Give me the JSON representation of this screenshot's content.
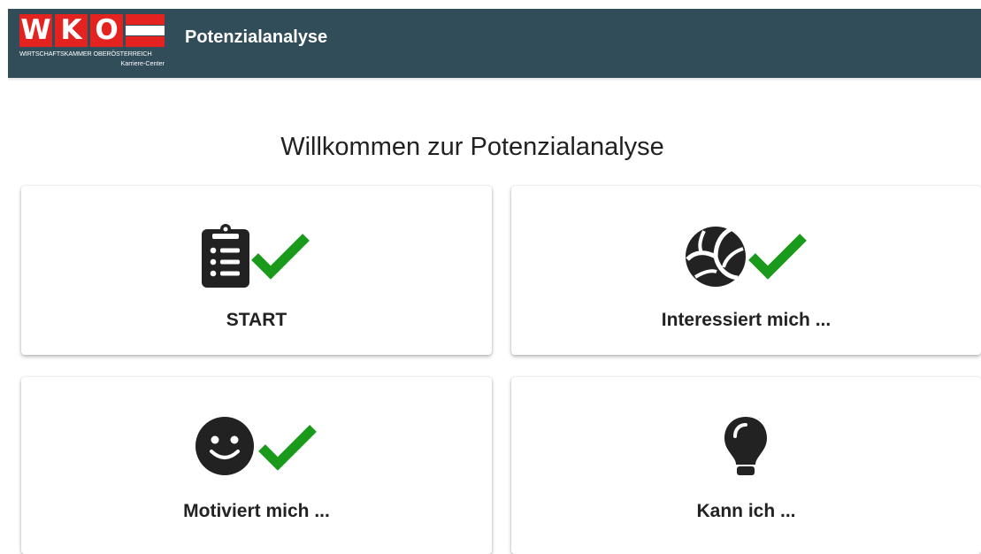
{
  "header": {
    "logo": {
      "letters": [
        "W",
        "K",
        "O"
      ],
      "subtitle": "WIRTSCHAFTSKAMMER OBERÖSTERREICH",
      "subtitle2": "Karriere-Center"
    },
    "title": "Potenzialanalyse"
  },
  "main": {
    "heading": "Willkommen zur Potenzialanalyse",
    "cards": [
      {
        "label": "START",
        "icon": "clipboard-list-icon",
        "completed": true
      },
      {
        "label": "Interessiert mich ...",
        "icon": "volleyball-icon",
        "completed": true
      },
      {
        "label": "Motiviert mich ...",
        "icon": "smiley-icon",
        "completed": true
      },
      {
        "label": "Kann ich ...",
        "icon": "lightbulb-icon",
        "completed": false
      }
    ]
  },
  "colors": {
    "header_bg": "#324d5a",
    "logo_red": "#e42320",
    "check_green": "#1a9a1a",
    "icon_dark": "#222222"
  }
}
